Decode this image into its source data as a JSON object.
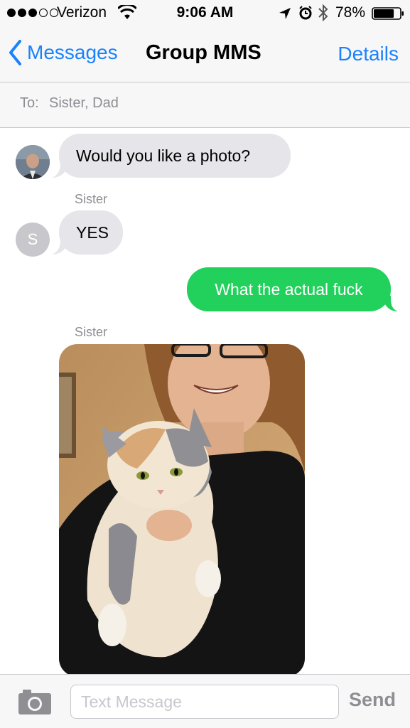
{
  "status_bar": {
    "carrier": "Verizon",
    "time": "9:06 AM",
    "battery": "78%",
    "battery_level": 0.78,
    "signal_bars": 3,
    "signal_total": 5
  },
  "nav": {
    "back_label": "Messages",
    "title": "Group MMS",
    "details_label": "Details"
  },
  "recipients": {
    "label": "To:",
    "value": "Sister, Dad"
  },
  "messages": [
    {
      "direction": "incoming",
      "text": "Would you like a photo?"
    },
    {
      "direction": "incoming",
      "sender": "Sister",
      "avatar_initial": "S",
      "text": "YES"
    },
    {
      "direction": "outgoing",
      "text": "What the actual fuck"
    },
    {
      "direction": "incoming",
      "sender": "Sister",
      "type": "photo",
      "photo_subject": "woman holding a calico cat"
    }
  ],
  "input": {
    "placeholder": "Text Message",
    "send_label": "Send"
  },
  "colors": {
    "ios_blue": "#1a82fb",
    "sms_green": "#21d15c",
    "incoming_gray": "#e5e5ea",
    "secondary_text": "#8e8e93"
  },
  "icons": [
    "signal-dots-icon",
    "wifi-icon",
    "location-arrow-icon",
    "alarm-clock-icon",
    "bluetooth-icon",
    "battery-icon",
    "chevron-left-icon",
    "camera-icon"
  ]
}
